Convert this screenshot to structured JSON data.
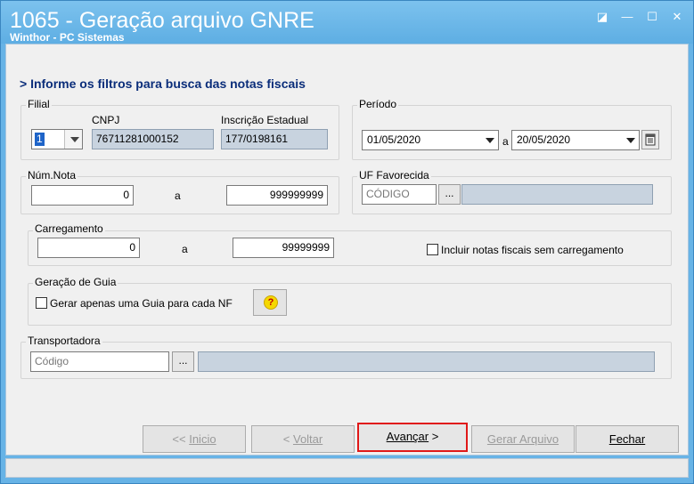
{
  "window": {
    "title": "1065 - Geração arquivo GNRE",
    "subtitle": "Winthor - PC Sistemas",
    "controls": {
      "pin": "◪",
      "minimize": "—",
      "maximize": "☐",
      "close": "✕"
    }
  },
  "header": "> Informe os filtros para busca das notas fiscais",
  "filial": {
    "group_label": "Filial",
    "selected": "1",
    "cnpj_label": "CNPJ",
    "cnpj_value": "76711281000152",
    "ie_label": "Inscrição Estadual",
    "ie_value": "177/0198161"
  },
  "periodo": {
    "group_label": "Período",
    "start": "01/05/2020",
    "separator": "a",
    "end": "20/05/2020"
  },
  "num_nota": {
    "group_label": "Núm.Nota",
    "from": "0",
    "separator": "a",
    "to": "999999999"
  },
  "uf_favorecida": {
    "group_label": "UF Favorecida",
    "placeholder": "CÓDIGO",
    "lookup_label": "...",
    "description": ""
  },
  "carregamento": {
    "group_label": "Carregamento",
    "from": "0",
    "separator": "a",
    "to": "99999999",
    "checkbox_label": "Incluir notas fiscais sem carregamento",
    "checkbox_checked": false
  },
  "geracao_guia": {
    "group_label": "Geração de Guia",
    "checkbox_label": "Gerar apenas uma Guia para cada NF",
    "checkbox_checked": false,
    "help_label": "?"
  },
  "transportadora": {
    "group_label": "Transportadora",
    "placeholder": "Código",
    "lookup_label": "...",
    "description": ""
  },
  "buttons": {
    "inicio": {
      "prefix": "<< ",
      "label": "Inicio",
      "enabled": false
    },
    "voltar": {
      "prefix": "< ",
      "label": "Voltar",
      "enabled": false
    },
    "avancar": {
      "label": "Avançar",
      "suffix": " >",
      "enabled": true,
      "highlighted": true
    },
    "gerar": {
      "label": "Gerar Arquivo",
      "enabled": false
    },
    "fechar": {
      "label": "Fechar",
      "enabled": true
    }
  }
}
